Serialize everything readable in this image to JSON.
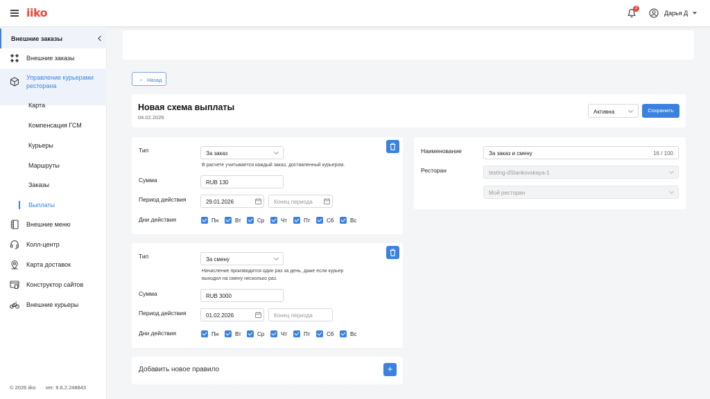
{
  "app": {
    "logo": "iiko"
  },
  "header": {
    "notifications_count": "2",
    "user_name": "Дарья Д"
  },
  "sidebar": {
    "section_title": "Внешние заказы",
    "items": [
      {
        "label": "Внешние заказы",
        "icon": "grid-star-icon"
      },
      {
        "label": "Управление курьерами ресторана",
        "icon": "box-icon"
      },
      {
        "label": "Внешние меню",
        "icon": "book-icon"
      },
      {
        "label": "Колл-центр",
        "icon": "headset-icon"
      },
      {
        "label": "Карта доставок",
        "icon": "map-pin-icon"
      },
      {
        "label": "Конструктор сайтов",
        "icon": "site-builder-icon"
      },
      {
        "label": "Внешние курьеры",
        "icon": "bicycle-icon"
      }
    ],
    "subitems": [
      "Карта",
      "Компенсация ГСМ",
      "Курьеры",
      "Маршруты",
      "Заказы",
      "Выплаты"
    ],
    "selected_subitem": "Выплаты",
    "footer_copyright": "© 2026 iiko",
    "footer_version": "ver: 9.6.2.248843"
  },
  "page": {
    "back_label": "Назад",
    "title": "Новая схема выплаты",
    "date": "04.02.2026",
    "status": "Активна",
    "save_label": "Сохранить"
  },
  "labels": {
    "type": "Тип",
    "amount": "Сумма",
    "period": "Период действия",
    "days": "Дни действия",
    "period_end_placeholder": "Конец периода"
  },
  "rules": [
    {
      "type": "За заказ",
      "hint": "В расчете учитывается каждый заказ, доставленный курьером.",
      "amount": "RUB 130",
      "period_start": "29.01.2026",
      "days": [
        "Пн",
        "Вт",
        "Ср",
        "Чт",
        "Пт",
        "Сб",
        "Вс"
      ]
    },
    {
      "type": "За смену",
      "hint": "Начисление производится один раз за день, даже если курьер выходил на смену несколько раз.",
      "amount": "RUB 3000",
      "period_start": "01.02.2026",
      "days": [
        "Пн",
        "Вт",
        "Ср",
        "Чт",
        "Пт",
        "Сб",
        "Вс"
      ]
    }
  ],
  "add_rule_label": "Добавить новое правило",
  "details": {
    "name_label": "Наименование",
    "name_value": "За заказ и смену",
    "name_counter": "16 / 100",
    "restaurant_label": "Ресторан",
    "restaurant_value": "testing-dStankovskaya-1",
    "restaurant_sub_value": "Мой ресторан"
  },
  "colors": {
    "accent": "#3b82e0",
    "brand": "#e8473b"
  }
}
